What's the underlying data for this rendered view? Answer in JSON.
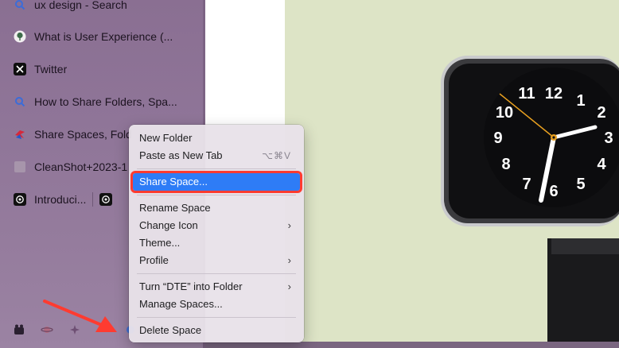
{
  "sidebar": {
    "tabs": [
      {
        "label": "ux design - Search",
        "icon": "search-icon"
      },
      {
        "label": "What is User Experience (...",
        "icon": "tree-icon"
      },
      {
        "label": "Twitter",
        "icon": "x-logo-icon"
      },
      {
        "label": "How to Share Folders, Spa...",
        "icon": "search-icon"
      },
      {
        "label": "Share Spaces, Fold",
        "icon": "bird-icon"
      },
      {
        "label": "CleanShot+2023-1",
        "icon": "file-icon"
      }
    ],
    "split_tab": {
      "label": "Introduci...",
      "icon": "openai-icon",
      "icon2": "openai-icon"
    }
  },
  "menu": {
    "new_folder": "New Folder",
    "paste_as_new_tab": "Paste as New Tab",
    "paste_shortcut": "⌥⌘V",
    "share_space": "Share Space...",
    "rename_space": "Rename Space",
    "change_icon": "Change Icon",
    "theme": "Theme...",
    "profile": "Profile",
    "turn_into_folder": "Turn “DTE” into Folder",
    "manage_spaces": "Manage Spaces...",
    "delete_space": "Delete Space",
    "chevron": "›"
  },
  "clock": {
    "numbers": [
      "12",
      "1",
      "2",
      "3",
      "4",
      "5",
      "6",
      "7",
      "8",
      "9",
      "10",
      "11"
    ]
  },
  "colors": {
    "sidebar": "#8f7598",
    "highlight": "#2e7cf6",
    "annotation": "#ff3b30",
    "content_bg": "#dde4c6"
  }
}
